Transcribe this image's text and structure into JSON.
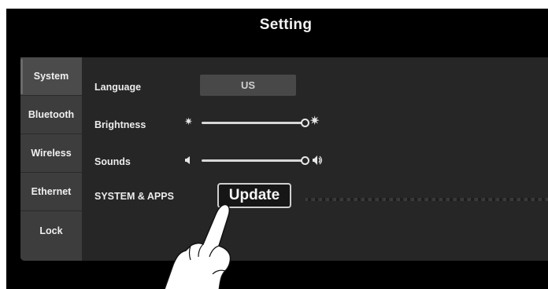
{
  "header": {
    "title": "Setting"
  },
  "sidebar": {
    "items": [
      {
        "label": "System",
        "active": true
      },
      {
        "label": "Bluetooth",
        "active": false
      },
      {
        "label": "Wireless",
        "active": false
      },
      {
        "label": "Ethernet",
        "active": false
      },
      {
        "label": "Lock",
        "active": false
      }
    ]
  },
  "settings": {
    "language": {
      "label": "Language",
      "value": "US"
    },
    "brightness": {
      "label": "Brightness",
      "level": 1.0,
      "icon_low": "sun-small-icon",
      "icon_high": "sun-large-icon"
    },
    "sounds": {
      "label": "Sounds",
      "level": 1.0,
      "icon_low": "speaker-low-icon",
      "icon_high": "speaker-high-icon"
    },
    "system_apps": {
      "label": "SYSTEM & APPS",
      "button_label": "Update"
    }
  },
  "icons": {
    "pointer": "pointing-hand-icon"
  },
  "colors": {
    "background": "#000000",
    "panel": "#262626",
    "sidebar": "#3d3d3d",
    "text": "#f0f0f0"
  }
}
